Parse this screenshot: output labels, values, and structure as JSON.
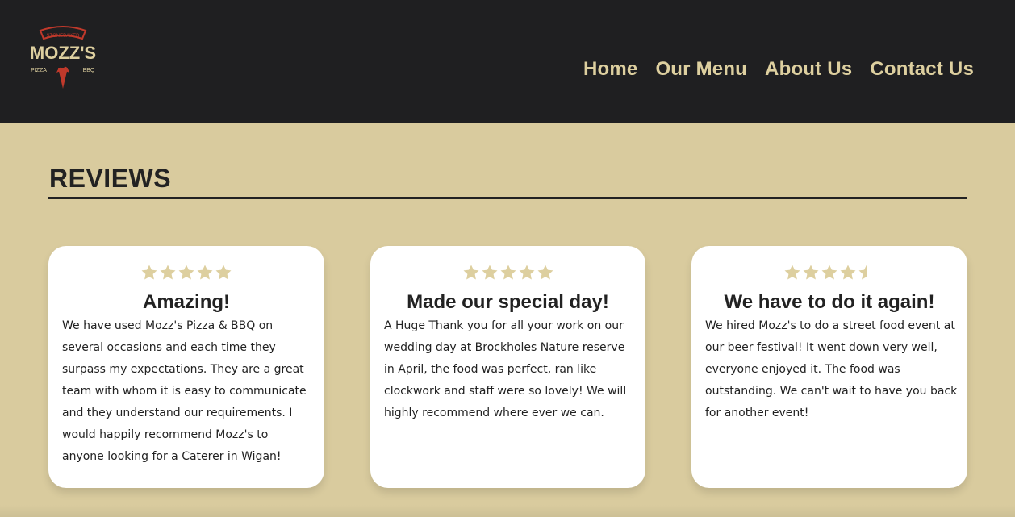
{
  "brand": {
    "logo_top_text": "STONEBAKED",
    "logo_name": "MOZZ'S",
    "logo_left": "PIZZA",
    "logo_right": "BBQ",
    "colors": {
      "header_bg": "#1f1f21",
      "page_bg": "#d9cb9e",
      "accent": "#ddcf9f",
      "logo_red": "#c0392b"
    }
  },
  "nav": {
    "items": [
      {
        "label": "Home"
      },
      {
        "label": "Our Menu"
      },
      {
        "label": "About Us"
      },
      {
        "label": "Contact Us"
      }
    ]
  },
  "reviews_section": {
    "title": "REVIEWS",
    "reviews": [
      {
        "rating": 5,
        "title": "Amazing!",
        "text": "We have used Mozz's Pizza & BBQ on several occasions and each time they surpass my expectations. They are a great team with whom it is easy to communicate and they understand our requirements. I would happily recommend Mozz's to anyone looking for a Caterer in Wigan!"
      },
      {
        "rating": 5,
        "title": "Made our special day!",
        "text": "A Huge Thank you for all your work on our wedding day at Brockholes Nature reserve in April, the food was perfect, ran like clockwork and staff were so lovely! We will highly recommend where ever we can."
      },
      {
        "rating": 4.5,
        "title": "We have to do it again!",
        "text": "We hired Mozz's to do a street food event at our beer festival! It went down very well, everyone enjoyed it. The food was outstanding. We can't wait to have you back for another event!"
      }
    ]
  },
  "icons": {
    "star": "star-icon",
    "logo": "pizza-logo-icon"
  }
}
